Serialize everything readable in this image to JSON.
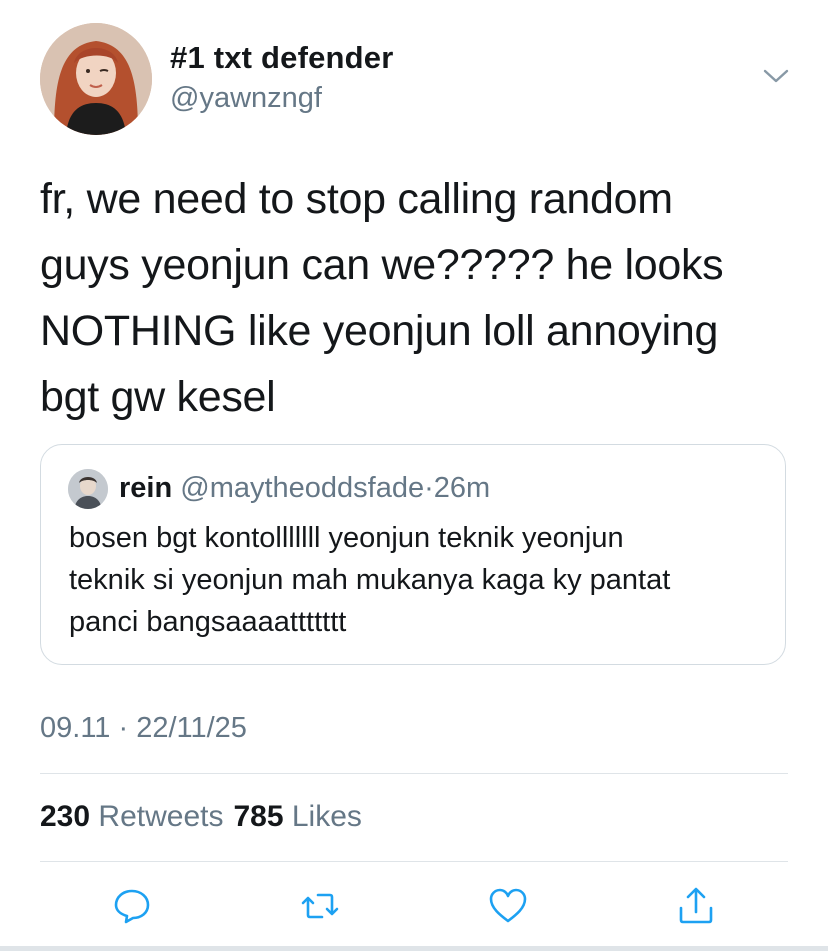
{
  "tweet": {
    "display_name": "#1 txt defender",
    "handle": "@yawnzngf",
    "text": "fr, we need to stop calling random\nguys yeonjun can we????? he looks\nNOTHING like yeonjun loll annoying\nbgt gw kesel",
    "timestamp": "09.11 · 22/11/25",
    "retweets_count": "230",
    "retweets_label": "Retweets",
    "likes_count": "785",
    "likes_label": "Likes"
  },
  "quoted": {
    "display_name": "rein",
    "handle": "@maytheoddsfade",
    "separator": "·",
    "time": "26m",
    "text": "bosen bgt kontolllllll yeonjun teknik yeonjun\nteknik si yeonjun mah mukanya kaga ky pantat\npanci bangsaaaattttttt"
  },
  "icons": {
    "more": "chevron-down-icon",
    "reply": "reply-icon",
    "retweet": "retweet-icon",
    "like": "heart-icon",
    "share": "share-icon"
  },
  "colors": {
    "text": "#14171a",
    "secondary": "#657786",
    "action_icon": "#1da1f2",
    "border": "#d3dbe1"
  }
}
